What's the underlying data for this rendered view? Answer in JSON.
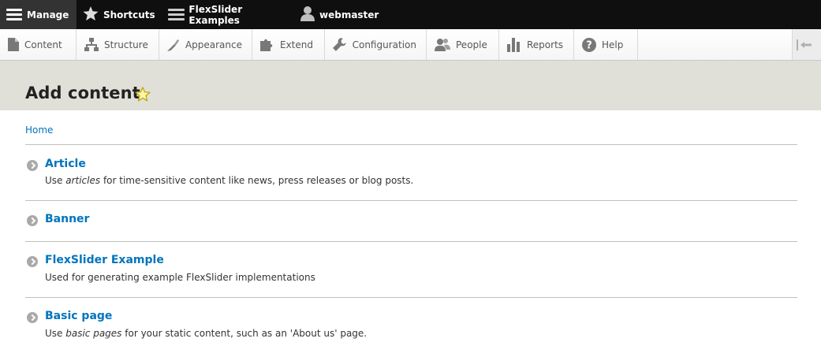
{
  "toolbar": {
    "manage_label": "Manage",
    "shortcuts_label": "Shortcuts",
    "flexslider_label": "FlexSlider Examples",
    "user_label": "webmaster"
  },
  "menu": {
    "items": [
      {
        "label": "Content",
        "icon": "file-icon"
      },
      {
        "label": "Structure",
        "icon": "sitemap-icon"
      },
      {
        "label": "Appearance",
        "icon": "paintbrush-icon"
      },
      {
        "label": "Extend",
        "icon": "puzzle-icon"
      },
      {
        "label": "Configuration",
        "icon": "wrench-icon"
      },
      {
        "label": "People",
        "icon": "people-icon"
      },
      {
        "label": "Reports",
        "icon": "bar-chart-icon"
      },
      {
        "label": "Help",
        "icon": "help-icon"
      }
    ]
  },
  "page": {
    "title": "Add content",
    "breadcrumb": "Home"
  },
  "content_types": [
    {
      "title": "Article",
      "desc_pre": "Use ",
      "desc_em": "articles",
      "desc_post": " for time-sensitive content like news, press releases or blog posts."
    },
    {
      "title": "Banner",
      "desc_pre": "",
      "desc_em": "",
      "desc_post": ""
    },
    {
      "title": "FlexSlider Example",
      "desc_pre": "Used for generating example FlexSlider implementations",
      "desc_em": "",
      "desc_post": ""
    },
    {
      "title": "Basic page",
      "desc_pre": "Use ",
      "desc_em": "basic pages",
      "desc_post": " for your static content, such as an 'About us' page."
    }
  ],
  "colors": {
    "link": "#0074bd",
    "toolbar_bg": "#0f0f0f",
    "header_bg": "#e0e0d8"
  }
}
